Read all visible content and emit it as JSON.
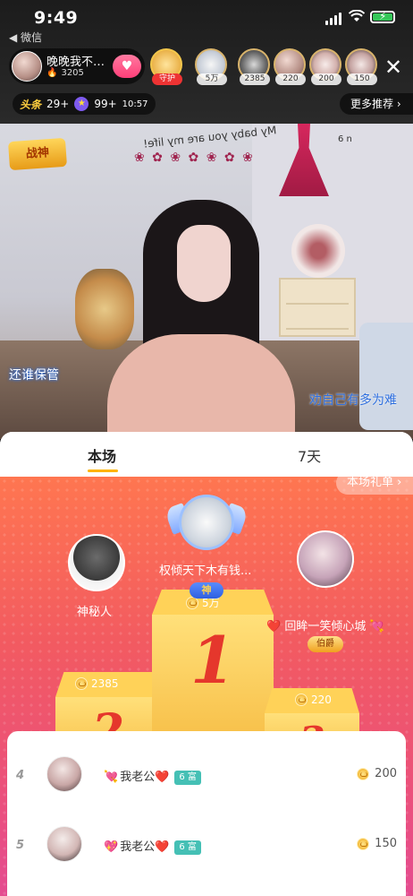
{
  "status_bar": {
    "time": "9:49",
    "back_app": "◀ 微信"
  },
  "host": {
    "name": "晚晚我不…",
    "heat": "3205"
  },
  "viewers": [
    {
      "count": ""
    },
    {
      "count": "5万"
    },
    {
      "count": "2385"
    },
    {
      "count": "220"
    },
    {
      "count": "200"
    },
    {
      "count": "150"
    }
  ],
  "toolbar": {
    "toutiao_brand": "头条",
    "toutiao_count": "29+",
    "star_count": "99+",
    "star_time": "10:57",
    "more_recommend": "更多推荐 ›"
  },
  "video": {
    "logo_text": "战神",
    "wall_decal": "My baby you are my life!",
    "caption_left": "还谁保管",
    "caption_right": "劝自己有多为难",
    "corner_tag": "6 n"
  },
  "tabs": [
    {
      "label": "本场",
      "active": true
    },
    {
      "label": "7天",
      "active": false
    }
  ],
  "gift_list_button": "本场礼单 ›",
  "podium": {
    "first": {
      "name": "权倾天下木有钱...",
      "badge": "神",
      "score": "5万",
      "numeral": "1"
    },
    "second": {
      "name": "神秘人",
      "score": "2385",
      "numeral": "2"
    },
    "third": {
      "name": "❤️ 回眸一笑倾心城 💘",
      "badge": "伯爵",
      "score": "220",
      "numeral": "3"
    }
  },
  "list": [
    {
      "rank": "4",
      "name": "我老公",
      "heart_left": "💘",
      "heart_right": "❤️",
      "rich": "6 富",
      "value": "200"
    },
    {
      "rank": "5",
      "name": "我老公",
      "heart_left": "💖",
      "heart_right": "❤️",
      "rich": "6 富",
      "value": "150"
    }
  ],
  "colors": {
    "accent": "#ffb400",
    "podium_top": "#ff7650",
    "podium_bottom": "#e44c90",
    "rich_badge": "#45c0b5"
  },
  "icons": [
    "back-arrow-icon",
    "signal-icon",
    "wifi-icon",
    "battery-icon",
    "fire-icon",
    "heart-follow-icon",
    "close-icon",
    "star-icon",
    "coin-icon"
  ]
}
